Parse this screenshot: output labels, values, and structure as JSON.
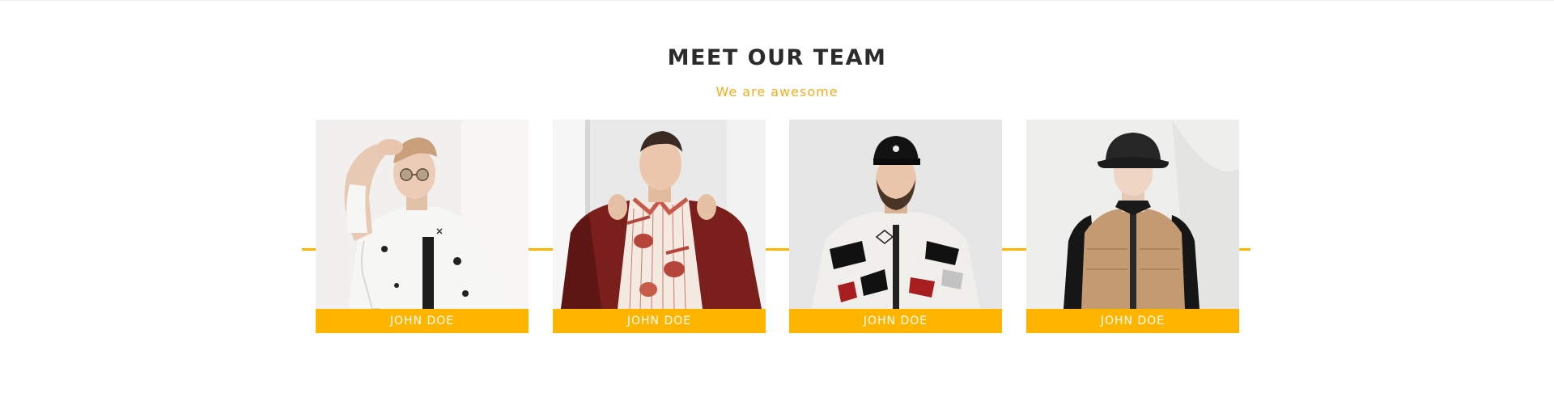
{
  "section": {
    "title": "MEET OUR TEAM",
    "subtitle": "We are awesome"
  },
  "colors": {
    "accent": "#ffb400",
    "subtitle": "#f4ac1b",
    "title": "#2b2b2b"
  },
  "team": [
    {
      "name": "JOHN DOE",
      "photo": "team-member-photo"
    },
    {
      "name": "JOHN DOE",
      "photo": "team-member-photo"
    },
    {
      "name": "JOHN DOE",
      "photo": "team-member-photo"
    },
    {
      "name": "JOHN DOE",
      "photo": "team-member-photo"
    }
  ]
}
